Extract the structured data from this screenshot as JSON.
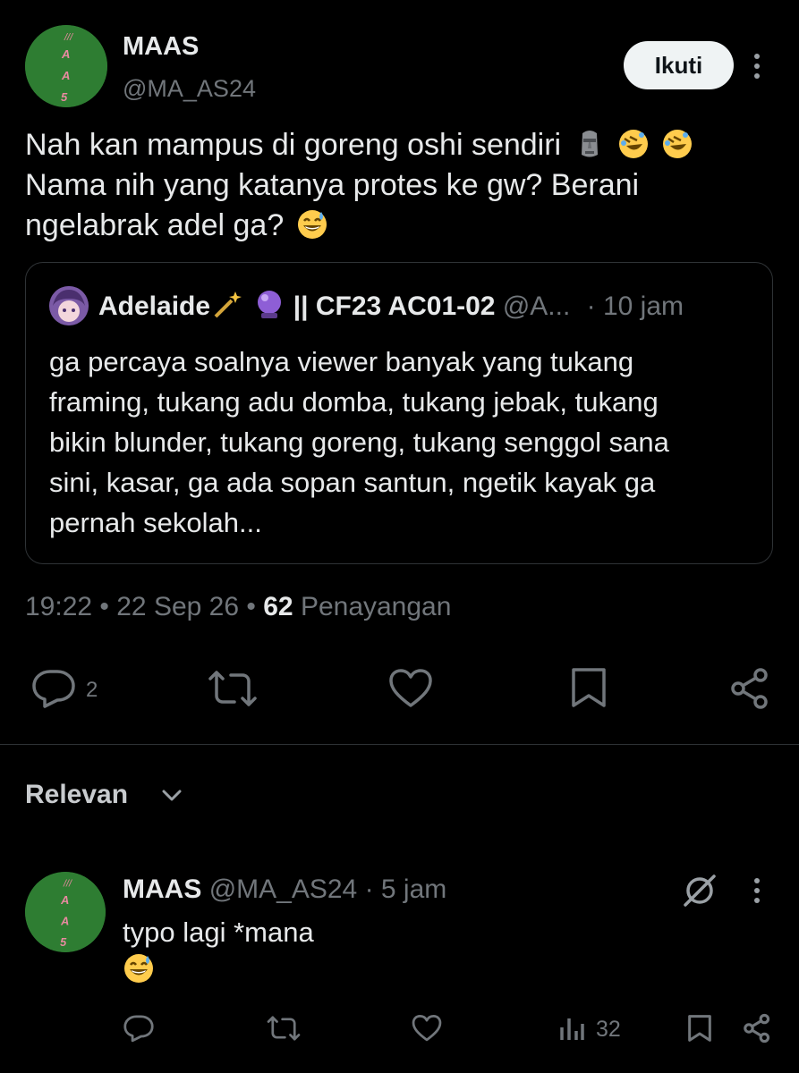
{
  "tweet": {
    "author_name": "MAAS",
    "author_handle": "@MA_AS24",
    "avatar_text": [
      "///",
      "A",
      "A",
      "5"
    ],
    "follow_label": "Ikuti",
    "text_lines": [
      "Nah kan mampus di goreng oshi sendiri",
      "Nama nih yang katanya protes ke gw? Berani",
      "ngelabrak adel ga?"
    ],
    "line1_emojis": [
      "moai-emoji",
      "rofl-emoji",
      "rofl-emoji"
    ],
    "line3_emoji": "grin-sweat-emoji",
    "timestamp": "19:22 • 22 Sep 26 •",
    "views_count": "62",
    "views_label": "Penayangan",
    "reply_count": "2"
  },
  "quote": {
    "author_name": "Adelaide",
    "name_emojis": [
      "magic-wand-emoji",
      "crystal-ball-emoji"
    ],
    "name_suffix": "|| CF23 AC01-02",
    "handle": "@A...",
    "time": "· 10 jam",
    "text_lines": [
      "ga percaya soalnya viewer banyak yang tukang",
      "framing, tukang adu domba, tukang jebak, tukang",
      "bikin blunder, tukang goreng, tukang senggol sana",
      "sini, kasar, ga ada sopan santun, ngetik kayak ga",
      "pernah sekolah..."
    ]
  },
  "section": {
    "sort_label": "Relevan"
  },
  "reply": {
    "author_name": "MAAS",
    "author_handle": "@MA_AS24",
    "time": "· 5 jam",
    "text": "typo lagi *mana",
    "emoji": "grin-sweat-emoji",
    "views_count": "32"
  },
  "colors": {
    "background": "#000000",
    "text": "#e7e9ea",
    "secondary": "#71767b",
    "border": "#2f3336",
    "avatar_green": "#2e7d32",
    "avatar_letters": "#e88aa0"
  }
}
